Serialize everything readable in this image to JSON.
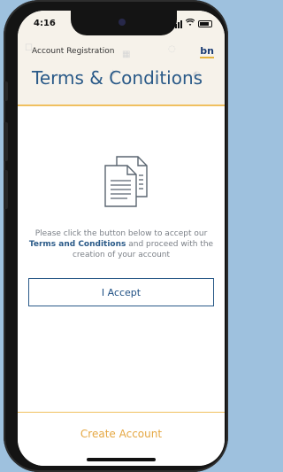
{
  "status_bar": {
    "time": "4:16"
  },
  "header": {
    "breadcrumb": "Account Registration",
    "logo": "bn",
    "title": "Terms & Conditions"
  },
  "content": {
    "icon": "documents-icon",
    "message_before": "Please click the button below to accept our",
    "message_link": "Terms and Conditions",
    "message_after": "and proceed with the creation of your account",
    "accept_button": "I Accept"
  },
  "footer": {
    "create_account": "Create Account"
  },
  "colors": {
    "title": "#2a5a88",
    "accent": "#e5a742",
    "header_bg": "#f6f2ea",
    "border_gold": "#f0c060"
  }
}
